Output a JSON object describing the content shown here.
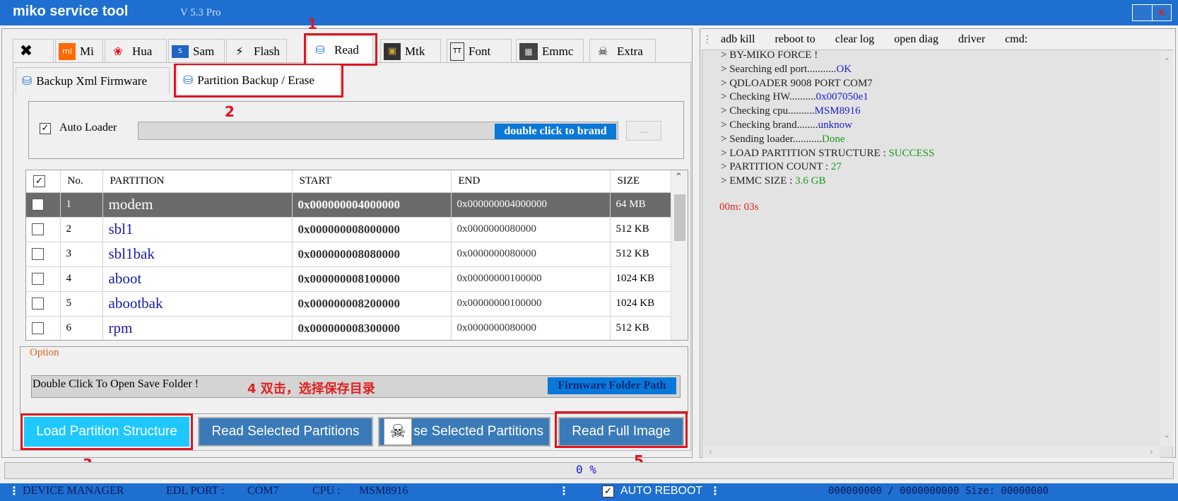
{
  "window": {
    "title": "miko service tool",
    "version": "V 5.3 Pro",
    "close_label": "x"
  },
  "tabs": [
    {
      "label": "",
      "icon": "tools-icon"
    },
    {
      "label": "Mi",
      "icon": "mi-icon"
    },
    {
      "label": "Hua",
      "icon": "huawei-icon"
    },
    {
      "label": "Sam",
      "icon": "samsung-icon"
    },
    {
      "label": "Flash",
      "icon": "flash-icon"
    },
    {
      "label": "Read",
      "icon": "database-icon"
    },
    {
      "label": "Mtk",
      "icon": "chip-icon"
    },
    {
      "label": "Font",
      "icon": "font-file-icon"
    },
    {
      "label": "Emmc",
      "icon": "emmc-icon"
    },
    {
      "label": "Extra",
      "icon": "extra-icon"
    }
  ],
  "subtabs": [
    {
      "label": "Backup Xml Firmware"
    },
    {
      "label": "Partition Backup / Erase"
    }
  ],
  "loader": {
    "label": "Auto Loader",
    "checked": true,
    "brand_button": "double click to brand",
    "more_button": "..."
  },
  "table": {
    "headers": [
      "No.",
      "PARTITION",
      "START",
      "END",
      "SIZE"
    ],
    "rows": [
      {
        "no": "1",
        "partition": "modem",
        "start": "0x000000004000000",
        "end": "0x000000004000000",
        "size": "64 MB",
        "selected": true
      },
      {
        "no": "2",
        "partition": "sbl1",
        "start": "0x000000008000000",
        "end": "0x0000000080000",
        "size": "512 KB"
      },
      {
        "no": "3",
        "partition": "sbl1bak",
        "start": "0x000000008080000",
        "end": "0x0000000080000",
        "size": "512 KB"
      },
      {
        "no": "4",
        "partition": "aboot",
        "start": "0x000000008100000",
        "end": "0x00000000100000",
        "size": "1024 KB"
      },
      {
        "no": "5",
        "partition": "abootbak",
        "start": "0x000000008200000",
        "end": "0x00000000100000",
        "size": "1024 KB"
      },
      {
        "no": "6",
        "partition": "rpm",
        "start": "0x000000008300000",
        "end": "0x0000000080000",
        "size": "512 KB"
      }
    ]
  },
  "option": {
    "label": "Option",
    "save_folder_text": "Double Click To Open Save Folder !",
    "firmware_path_button": "Firmware Folder Path"
  },
  "buttons": {
    "load": "Load Partition Structure",
    "read_selected": "Read Selected Partitions",
    "erase_selected": "se Selected Partitions",
    "read_full": "Read Full Image"
  },
  "annotations": {
    "m1": "1",
    "m2": "2",
    "m3": "3",
    "m4": "4 双击，选择保存目录",
    "m5": "5"
  },
  "right_toolbar": [
    "adb kill",
    "reboot to",
    "clear log",
    "open diag",
    "driver",
    "cmd:"
  ],
  "log": [
    {
      "text": "> BY-MIKO FORCE !",
      "val": "",
      "cls": ""
    },
    {
      "text": "> Searching edl port...........",
      "val": "OK",
      "cls": "v"
    },
    {
      "text": "> QDLOADER 9008 PORT COM7",
      "val": "",
      "cls": ""
    },
    {
      "text": "> Checking HW..........",
      "val": "0x007050e1",
      "cls": "v"
    },
    {
      "text": "> Checking cpu..........",
      "val": "MSM8916",
      "cls": "v"
    },
    {
      "text": "> Checking brand........",
      "val": "unknow",
      "cls": "v"
    },
    {
      "text": "> Sending loader...........",
      "val": "Done",
      "cls": "g"
    },
    {
      "text": "> LOAD PARTITION  STRUCTURE  :  ",
      "val": "SUCCESS",
      "cls": "g"
    },
    {
      "text": "> PARTITION COUNT  :  ",
      "val": "27",
      "cls": "g"
    },
    {
      "text": "> EMMC SIZE   :  ",
      "val": "3.6 GB",
      "cls": "g"
    }
  ],
  "log_timer": "00m: 03s",
  "progress": {
    "text": "0 %",
    "value": 0
  },
  "status": {
    "device_manager": "DEVICE MANAGER",
    "edl_port_label": "EDL PORT :",
    "edl_port_value": "COM7",
    "cpu_label": "CPU :",
    "cpu_value": "MSM8916",
    "auto_reboot": "AUTO REBOOT",
    "auto_reboot_checked": true,
    "counters": "000000000 / 0000000000 Size: 00000000"
  },
  "colors": {
    "accent": "#1e6fd0",
    "highlight": "#e0141e",
    "link_blue": "#1a1aa8",
    "success_green": "#1a9a1a"
  }
}
